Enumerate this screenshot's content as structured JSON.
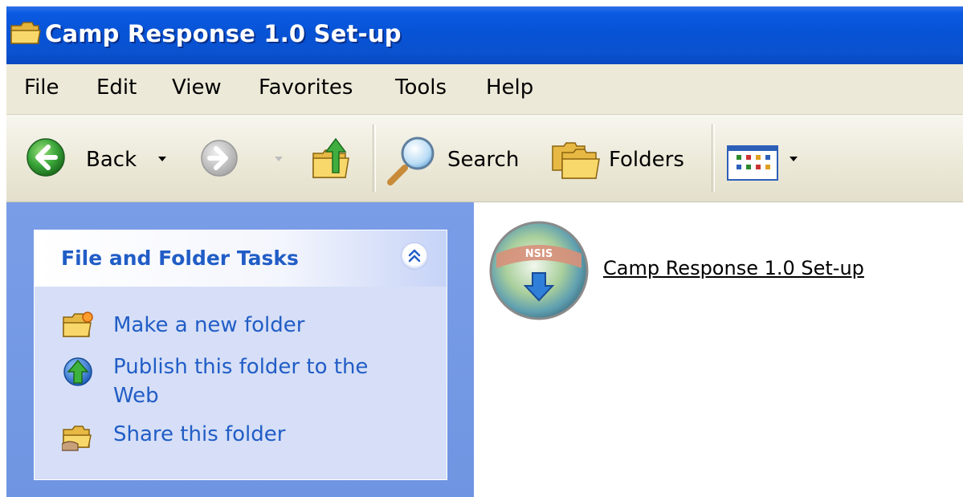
{
  "window": {
    "title": "Camp Response 1.0 Set-up"
  },
  "menubar": {
    "items": [
      "File",
      "Edit",
      "View",
      "Favorites",
      "Tools",
      "Help"
    ]
  },
  "toolbar": {
    "back_label": "Back",
    "search_label": "Search",
    "folders_label": "Folders"
  },
  "taskpane": {
    "panel_title": "File and Folder Tasks",
    "tasks": [
      {
        "line1": "Make a new folder",
        "icon": "new-folder-icon"
      },
      {
        "line1": "Publish this folder to the",
        "line2": "Web",
        "icon": "publish-web-icon"
      },
      {
        "line1": "Share this folder",
        "icon": "share-folder-icon"
      }
    ]
  },
  "content": {
    "items": [
      {
        "label": "Camp Response 1.0 Set-up",
        "icon_text": "NSIS",
        "icon": "nsis-installer-icon"
      }
    ]
  },
  "colors": {
    "titlebar": "#0753d6",
    "task_link": "#215dc6",
    "taskpane_bg": "#7a9de7",
    "panel_bg": "#d6dff7"
  }
}
